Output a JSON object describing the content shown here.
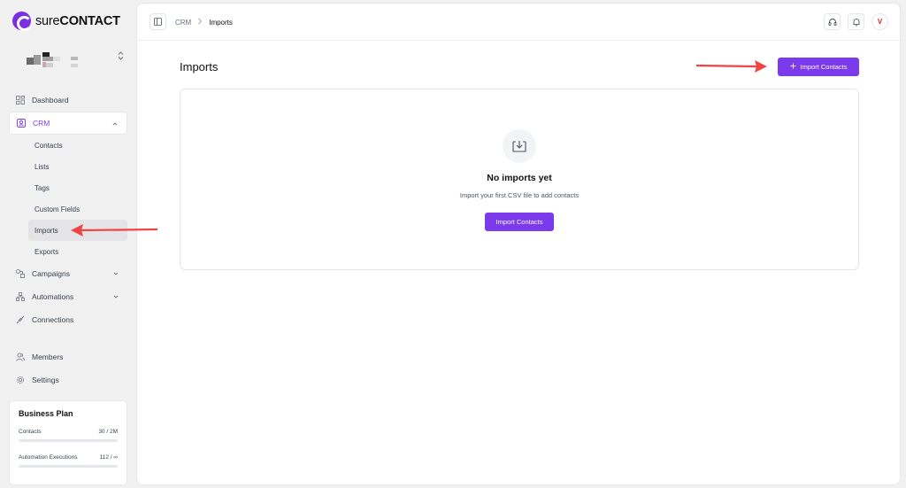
{
  "app": {
    "brand_prefix": "sure",
    "brand_suffix": "CONTACT",
    "accent": "#7c3aed"
  },
  "sidebar": {
    "nav": [
      {
        "label": "Dashboard",
        "icon": "dashboard-icon"
      },
      {
        "label": "CRM",
        "icon": "contacts-card-icon",
        "expanded": true
      },
      {
        "label": "Campaigns",
        "icon": "campaigns-icon"
      },
      {
        "label": "Automations",
        "icon": "automations-icon"
      },
      {
        "label": "Connections",
        "icon": "plug-icon"
      }
    ],
    "crm_sub": [
      "Contacts",
      "Lists",
      "Tags",
      "Custom Fields",
      "Imports",
      "Exports"
    ],
    "active_sub": "Imports",
    "bottom": [
      {
        "label": "Members",
        "icon": "users-icon"
      },
      {
        "label": "Settings",
        "icon": "gear-icon"
      }
    ],
    "plan": {
      "title": "Business Plan",
      "contacts_label": "Contacts",
      "contacts_value": "30 / 2M",
      "contacts_progress": 0.0,
      "automation_label": "Automation Executions",
      "automation_value": "112 / ∞",
      "automation_progress": 0.0
    }
  },
  "topbar": {
    "breadcrumb": [
      "CRM",
      "Imports"
    ],
    "avatar_initial": "V"
  },
  "page": {
    "title": "Imports",
    "import_button": "Import Contacts",
    "empty_title": "No imports yet",
    "empty_subtitle": "Import your first CSV file to add contacts",
    "empty_button": "Import Contacts"
  }
}
